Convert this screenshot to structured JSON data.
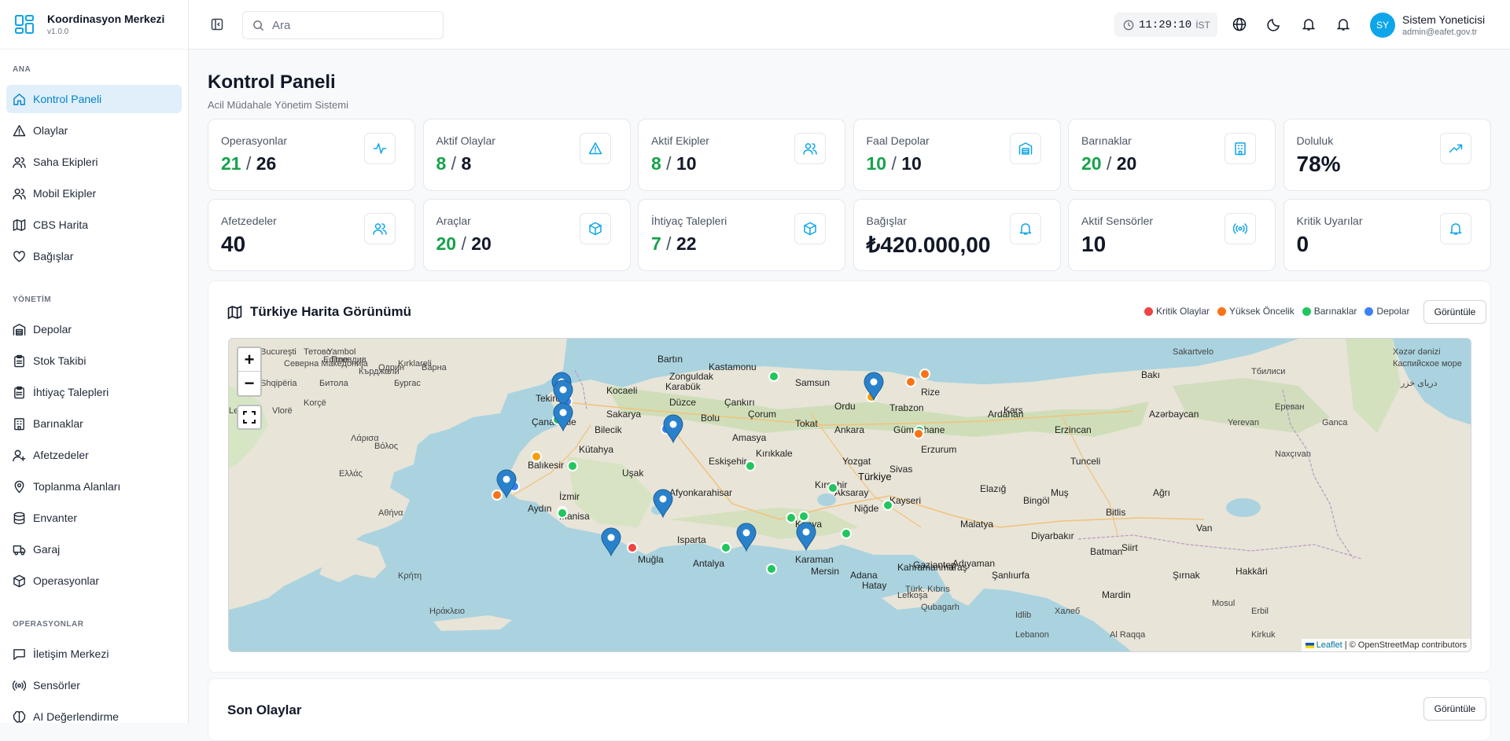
{
  "brand": {
    "title": "Koordinasyon Merkezi",
    "version": "v1.0.0"
  },
  "sidebar": {
    "sections": [
      {
        "label": "ANA",
        "items": [
          {
            "label": "Kontrol Paneli",
            "icon": "home-icon",
            "active": true
          },
          {
            "label": "Olaylar",
            "icon": "alert-triangle-icon"
          },
          {
            "label": "Saha Ekipleri",
            "icon": "users-icon"
          },
          {
            "label": "Mobil Ekipler",
            "icon": "users-icon"
          },
          {
            "label": "CBS Harita",
            "icon": "map-icon"
          },
          {
            "label": "Bağışlar",
            "icon": "heart-icon"
          }
        ]
      },
      {
        "label": "YÖNETİM",
        "items": [
          {
            "label": "Depolar",
            "icon": "warehouse-icon"
          },
          {
            "label": "Stok Takibi",
            "icon": "clipboard-icon"
          },
          {
            "label": "İhtiyaç Talepleri",
            "icon": "clipboard-list-icon"
          },
          {
            "label": "Barınaklar",
            "icon": "building-icon"
          },
          {
            "label": "Afetzedeler",
            "icon": "user-plus-icon"
          },
          {
            "label": "Toplanma Alanları",
            "icon": "map-pin-icon"
          },
          {
            "label": "Envanter",
            "icon": "database-icon"
          },
          {
            "label": "Garaj",
            "icon": "truck-icon"
          },
          {
            "label": "Operasyonlar",
            "icon": "box-icon"
          }
        ]
      },
      {
        "label": "OPERASYONLAR",
        "items": [
          {
            "label": "İletişim Merkezi",
            "icon": "message-square-icon"
          },
          {
            "label": "Sensörler",
            "icon": "radio-icon"
          },
          {
            "label": "AI Değerlendirme",
            "icon": "brain-icon"
          }
        ]
      }
    ]
  },
  "topbar": {
    "search_placeholder": "Ara",
    "time": "11:29:10",
    "timezone": "İST",
    "user_name": "Sistem Yoneticisi",
    "user_email": "admin@eafet.gov.tr",
    "user_initials": "SY"
  },
  "page": {
    "title": "Kontrol Paneli",
    "subtitle": "Acil Müdahale Yönetim Sistemi"
  },
  "stats": [
    {
      "label": "Operasyonlar",
      "value": "21",
      "total": "26",
      "icon": "activity-icon"
    },
    {
      "label": "Aktif Olaylar",
      "value": "8",
      "total": "8",
      "icon": "alert-triangle-icon"
    },
    {
      "label": "Aktif Ekipler",
      "value": "8",
      "total": "10",
      "icon": "users-icon"
    },
    {
      "label": "Faal Depolar",
      "value": "10",
      "total": "10",
      "icon": "warehouse-icon"
    },
    {
      "label": "Barınaklar",
      "value": "20",
      "total": "20",
      "icon": "building-icon"
    },
    {
      "label": "Doluluk",
      "value": "78%",
      "icon": "trending-up-icon"
    },
    {
      "label": "Afetzedeler",
      "value": "40",
      "icon": "users-icon"
    },
    {
      "label": "Araçlar",
      "value": "20",
      "total": "20",
      "icon": "box-icon"
    },
    {
      "label": "İhtiyaç Talepleri",
      "value": "7",
      "total": "22",
      "icon": "box-icon"
    },
    {
      "label": "Bağışlar",
      "value": "₺420.000,00",
      "icon": "bell-icon"
    },
    {
      "label": "Aktif Sensörler",
      "value": "10",
      "icon": "radio-icon"
    },
    {
      "label": "Kritik Uyarılar",
      "value": "0",
      "icon": "bell-icon"
    }
  ],
  "map_section": {
    "title": "Türkiye Harita Görünümü",
    "legend": [
      {
        "label": "Kritik Olaylar",
        "color": "#ef4444"
      },
      {
        "label": "Yüksek Öncelik",
        "color": "#f97316"
      },
      {
        "label": "Barınaklar",
        "color": "#22c55e"
      },
      {
        "label": "Depolar",
        "color": "#3b82f6"
      }
    ],
    "view_button": "Görüntüle",
    "zoom_in": "+",
    "zoom_out": "−",
    "attribution_leaflet": "Leaflet",
    "attribution_rest": " | © OpenStreetMap contributors",
    "cities": [
      "Kocaeli",
      "Tekirdağ",
      "Zonguldak",
      "Karabük",
      "Bartın",
      "Kastamonu",
      "Samsun",
      "Amasya",
      "Tokat",
      "Ordu",
      "Trabzon",
      "Rize",
      "Gümüşhane",
      "Erzurum",
      "Ardahan",
      "Kars",
      "Çankırı",
      "Çorum",
      "Bolu",
      "Düzce",
      "Sakarya",
      "Bilecik",
      "Kütahya",
      "Balıkesir",
      "Çanakkale",
      "Manisa",
      "İzmir",
      "Aydın",
      "Uşak",
      "Eskişehir",
      "Afyonkarahisar",
      "Isparta",
      "Antalya",
      "Muğla",
      "Konya",
      "Karaman",
      "Aksaray",
      "Niğde",
      "Kayseri",
      "Sivas",
      "Yozgat",
      "Kırşehir",
      "Kırıkkale",
      "Ankara",
      "Türkiye",
      "Mersin",
      "Adana",
      "Hatay",
      "Kahramanmaraş",
      "Gaziantep",
      "Adıyaman",
      "Malatya",
      "Elazığ",
      "Bingöl",
      "Muş",
      "Bitlis",
      "Batman",
      "Siirt",
      "Diyarbakır",
      "Şanlıurfa",
      "Mardin",
      "Erzincan",
      "Tunceli",
      "Bakı",
      "Azərbaycan",
      "Ağrı",
      "Van",
      "Hakkâri",
      "Şırnak"
    ],
    "foreign_labels": [
      "Bucureşti",
      "Варна",
      "Бургас",
      "Пловдив",
      "Одрин",
      "Edirne",
      "Kırklareli",
      "Yambol",
      "Кърджали",
      "Северна Македонија",
      "Тетово",
      "Shqipëria",
      "Битола",
      "Korçë",
      "Vlorë",
      "Lecce",
      "Λάρισα",
      "Βόλος",
      "Ελλάς",
      "Αθήνα",
      "Κρήτη",
      "Ηράκλειο",
      "Qubagarh",
      "Lefkoşa",
      "Türk. Kıbrıs",
      "Lebanon",
      "Халеб",
      "Idlib",
      "Al Raqqa",
      "Erbil",
      "Mosul",
      "Kirkuk",
      "Sakartvelo",
      "Тбилиси",
      "Ереван",
      "Yerevan",
      "Naxçıvan",
      "Ganca",
      "Xəzər dənizi",
      "Каспийское море",
      "دریای خزر"
    ]
  },
  "recent": {
    "title": "Son Olaylar",
    "view_button": "Görüntüle"
  }
}
